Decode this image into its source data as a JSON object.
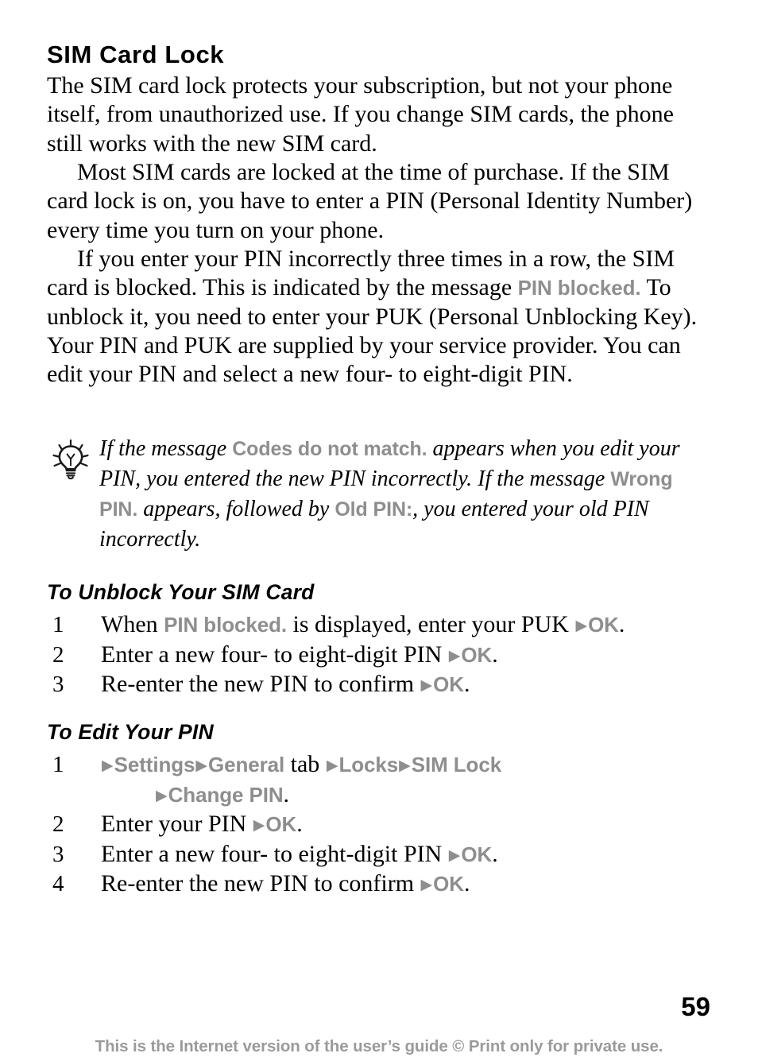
{
  "document": {
    "page_number": "59",
    "footer_note": "This is the Internet version of the user’s guide © Print only for private use.",
    "heading": "SIM Card Lock"
  },
  "colors": {
    "ui_label_gray": "#8e8e8e",
    "footer_gray": "#9a9a9a",
    "text_black": "#000000",
    "background": "#ffffff"
  },
  "body": {
    "para1": "The SIM card lock protects your subscription, but not your phone itself, from unauthorized use. If you change SIM cards, the phone still works with the new SIM card.",
    "para2": "Most SIM cards are locked at the time of purchase. If the SIM card lock is on, you have to enter a PIN (Personal Identity Number) every time you turn on your phone.",
    "para3_part1": "If you enter your PIN incorrectly three times in a row, the SIM card is blocked. This is indicated by the message ",
    "para3_label": "PIN blocked.",
    "para3_part2": " To unblock it, you need to enter your PUK (Personal Unblocking Key). Your PIN and PUK are supplied by your service provider. You can edit your PIN and select a new four- to eight-digit PIN."
  },
  "tip": {
    "icon": "lightbulb-icon",
    "part1": "If the message ",
    "label1": "Codes do not match.",
    "part2": " appears when you edit your PIN, you entered the new PIN incorrectly. If the message ",
    "label2": "Wrong PIN.",
    "part3": " appears, followed by ",
    "label3": "Old PIN:",
    "part4": ", you entered your old PIN incorrectly."
  },
  "section_unblock": {
    "heading": "To Unblock Your SIM Card",
    "steps": [
      {
        "number": "1",
        "text_a": "When ",
        "label_a": "PIN blocked.",
        "text_b": " is displayed, enter your PUK ",
        "arrow": "▶",
        "label_b": "OK",
        "text_c": "."
      },
      {
        "number": "2",
        "text_a": "Enter a new four- to eight-digit PIN ",
        "arrow": "▶",
        "label_b": "OK",
        "text_c": "."
      },
      {
        "number": "3",
        "text_a": "Re-enter the new PIN to confirm ",
        "arrow": "▶",
        "label_b": "OK",
        "text_c": "."
      }
    ]
  },
  "section_edit": {
    "heading": "To Edit Your PIN",
    "step1": {
      "number": "1",
      "arrow1": "▶",
      "menu1": "Settings",
      "arrow2": "▶",
      "menu2": "General",
      "word_tab": " tab ",
      "arrow3": "▶",
      "menu3": "Locks",
      "arrow4": "▶",
      "menu4": "SIM Lock",
      "arrow5": "▶",
      "menu5": "Change PIN",
      "period": "."
    },
    "steps": [
      {
        "number": "2",
        "text_a": "Enter your PIN ",
        "arrow": "▶",
        "label_b": "OK",
        "text_c": "."
      },
      {
        "number": "3",
        "text_a": "Enter a new four- to eight-digit PIN ",
        "arrow": "▶",
        "label_b": "OK",
        "text_c": "."
      },
      {
        "number": "4",
        "text_a": "Re-enter the new PIN to confirm ",
        "arrow": "▶",
        "label_b": "OK",
        "text_c": "."
      }
    ]
  }
}
